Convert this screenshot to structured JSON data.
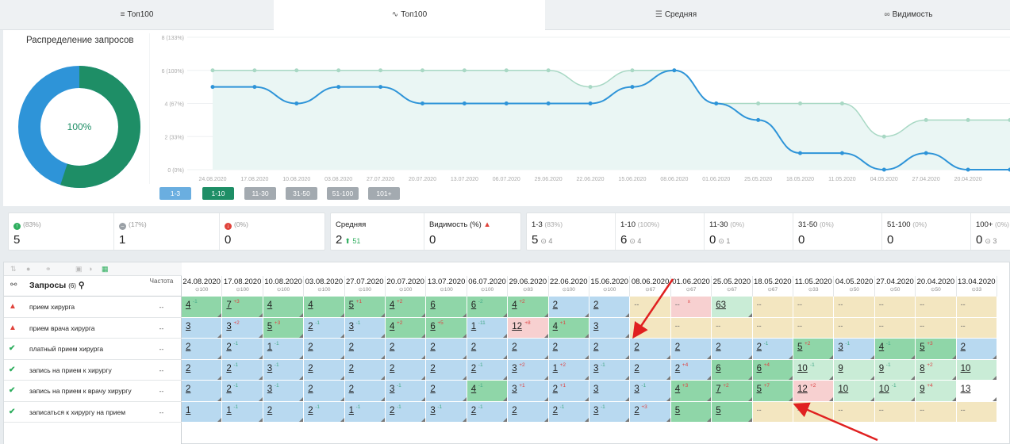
{
  "tabs": [
    {
      "label": "Топ100",
      "icon": "layers-icon"
    },
    {
      "label": "Топ100",
      "icon": "trend-icon"
    },
    {
      "label": "Средняя",
      "icon": "list-icon"
    },
    {
      "label": "Видимость",
      "icon": "glasses-icon"
    }
  ],
  "distribution": {
    "title": "Распределение запросов",
    "center": "100%",
    "segments": [
      {
        "color": "#2e94d8",
        "share": 0.45
      },
      {
        "color": "#1e8e66",
        "share": 0.55
      }
    ]
  },
  "chart_data": {
    "type": "line",
    "y_ticks": [
      "0 (0%)",
      "2 (33%)",
      "4 (67%)",
      "6 (100%)",
      "8 (133%)"
    ],
    "ylim": [
      0,
      8
    ],
    "x": [
      "24.08.2020",
      "17.08.2020",
      "10.08.2020",
      "03.08.2020",
      "27.07.2020",
      "20.07.2020",
      "13.07.2020",
      "06.07.2020",
      "29.06.2020",
      "22.06.2020",
      "15.06.2020",
      "08.06.2020",
      "01.06.2020",
      "25.05.2020",
      "18.05.2020",
      "11.05.2020",
      "04.05.2020",
      "27.04.2020",
      "20.04.2020"
    ],
    "series": [
      {
        "values": [
          6,
          6,
          6,
          6,
          6,
          6,
          6,
          6,
          6,
          5,
          6,
          6,
          4,
          4,
          4,
          4,
          2,
          3,
          3,
          3
        ],
        "color": "#a8d8c4"
      },
      {
        "values": [
          5,
          5,
          4,
          5,
          5,
          4,
          4,
          4,
          4,
          4,
          5,
          6,
          4,
          3,
          1,
          1,
          0,
          1,
          0,
          0
        ],
        "color": "#2e94d8"
      }
    ],
    "ranges": [
      {
        "label": "1-3",
        "color": "#6aaee0"
      },
      {
        "label": "1-10",
        "color": "#1e8e66"
      },
      {
        "label": "11-30",
        "color": "#a3aab0"
      },
      {
        "label": "31-50",
        "color": "#a3aab0"
      },
      {
        "label": "51-100",
        "color": "#a3aab0"
      },
      {
        "label": "101+",
        "color": "#a3aab0"
      }
    ]
  },
  "stats": {
    "movement": [
      {
        "pct": "(83%)",
        "value": "5",
        "color": "#2eae5e",
        "icon": "arrow-up-icon"
      },
      {
        "pct": "(17%)",
        "value": "1",
        "color": "#9aa0a6",
        "icon": "minus-icon"
      },
      {
        "pct": "(0%)",
        "value": "0",
        "color": "#e0433b",
        "icon": "arrow-down-icon"
      }
    ],
    "avg": {
      "label": "Средняя",
      "value": "2",
      "delta": "51"
    },
    "visibility": {
      "label": "Видимость (%)",
      "value": "0"
    },
    "ranges": [
      {
        "label": "1-3",
        "pct": "(83%)",
        "value": "5",
        "delta": "4"
      },
      {
        "label": "1-10",
        "pct": "(100%)",
        "value": "6",
        "delta": "4"
      },
      {
        "label": "11-30",
        "pct": "(0%)",
        "value": "0",
        "delta": "1"
      },
      {
        "label": "31-50",
        "pct": "(0%)",
        "value": "0",
        "delta": ""
      },
      {
        "label": "51-100",
        "pct": "(0%)",
        "value": "0",
        "delta": ""
      },
      {
        "label": "100+",
        "pct": "(0%)",
        "value": "0",
        "delta": "3"
      }
    ]
  },
  "table": {
    "header": {
      "queries": "Запросы",
      "count": "(6)",
      "freq": "Частота"
    },
    "dates": [
      {
        "d": "24.08.2020",
        "s": "100"
      },
      {
        "d": "17.08.2020",
        "s": "100"
      },
      {
        "d": "10.08.2020",
        "s": "100"
      },
      {
        "d": "03.08.2020",
        "s": "100"
      },
      {
        "d": "27.07.2020",
        "s": "100"
      },
      {
        "d": "20.07.2020",
        "s": "100"
      },
      {
        "d": "13.07.2020",
        "s": "100"
      },
      {
        "d": "06.07.2020",
        "s": "100"
      },
      {
        "d": "29.06.2020",
        "s": "83"
      },
      {
        "d": "22.06.2020",
        "s": "100"
      },
      {
        "d": "15.06.2020",
        "s": "100"
      },
      {
        "d": "08.06.2020",
        "s": "67"
      },
      {
        "d": "01.06.2020",
        "s": "67"
      },
      {
        "d": "25.05.2020",
        "s": "67"
      },
      {
        "d": "18.05.2020",
        "s": "67"
      },
      {
        "d": "11.05.2020",
        "s": "33"
      },
      {
        "d": "04.05.2020",
        "s": "50"
      },
      {
        "d": "27.04.2020",
        "s": "50"
      },
      {
        "d": "20.04.2020",
        "s": "50"
      },
      {
        "d": "13.04.2020",
        "s": "33"
      }
    ],
    "rows": [
      {
        "kw": "прием хирурга",
        "status": "warn",
        "freq": "--",
        "cells": [
          [
            "4",
            "-1",
            "g"
          ],
          [
            "7",
            "+3",
            "g"
          ],
          [
            "4",
            "",
            "g"
          ],
          [
            "4",
            "",
            "g"
          ],
          [
            "5",
            "+1",
            "g"
          ],
          [
            "4",
            "+2",
            "g"
          ],
          [
            "6",
            "",
            "g"
          ],
          [
            "6",
            "-2",
            "g"
          ],
          [
            "4",
            "+2",
            "g"
          ],
          [
            "2",
            "",
            "b"
          ],
          [
            "2",
            "",
            "b"
          ],
          [
            "--",
            "",
            "y"
          ],
          [
            "--",
            "x",
            "r"
          ],
          [
            "63",
            "",
            "l"
          ],
          [
            "--",
            "",
            "y"
          ],
          [
            "--",
            "",
            "y"
          ],
          [
            "--",
            "",
            "y"
          ],
          [
            "--",
            "",
            "y"
          ],
          [
            "--",
            "",
            "y"
          ],
          [
            "--",
            "",
            "y"
          ]
        ]
      },
      {
        "kw": "прием врача хирурга",
        "status": "warn",
        "freq": "--",
        "cells": [
          [
            "3",
            "",
            "b"
          ],
          [
            "3",
            "+2",
            "b"
          ],
          [
            "5",
            "+3",
            "g"
          ],
          [
            "2",
            "-1",
            "b"
          ],
          [
            "3",
            "-1",
            "b"
          ],
          [
            "4",
            "+2",
            "g"
          ],
          [
            "6",
            "+5",
            "g"
          ],
          [
            "1",
            "-11",
            "b"
          ],
          [
            "12",
            "+8",
            "r"
          ],
          [
            "4",
            "+1",
            "g"
          ],
          [
            "3",
            "",
            "b"
          ],
          [
            "--",
            "",
            "y"
          ],
          [
            "--",
            "",
            "y"
          ],
          [
            "--",
            "",
            "y"
          ],
          [
            "--",
            "",
            "y"
          ],
          [
            "--",
            "",
            "y"
          ],
          [
            "--",
            "",
            "y"
          ],
          [
            "--",
            "",
            "y"
          ],
          [
            "--",
            "",
            "y"
          ],
          [
            "--",
            "",
            "y"
          ]
        ]
      },
      {
        "kw": "платный прием хирурга",
        "status": "ok",
        "freq": "--",
        "cells": [
          [
            "2",
            "",
            "b"
          ],
          [
            "2",
            "-1",
            "b"
          ],
          [
            "1",
            "-1",
            "b"
          ],
          [
            "2",
            "",
            "b"
          ],
          [
            "2",
            "",
            "b"
          ],
          [
            "2",
            "",
            "b"
          ],
          [
            "2",
            "",
            "b"
          ],
          [
            "2",
            "",
            "b"
          ],
          [
            "2",
            "",
            "b"
          ],
          [
            "2",
            "",
            "b"
          ],
          [
            "2",
            "",
            "b"
          ],
          [
            "2",
            "",
            "b"
          ],
          [
            "2",
            "",
            "b"
          ],
          [
            "2",
            "",
            "b"
          ],
          [
            "2",
            "-1",
            "b"
          ],
          [
            "5",
            "+2",
            "g"
          ],
          [
            "3",
            "-1",
            "b"
          ],
          [
            "4",
            "-1",
            "g"
          ],
          [
            "5",
            "+3",
            "g"
          ],
          [
            "2",
            "",
            "b"
          ]
        ]
      },
      {
        "kw": "запись на прием к хирургу",
        "status": "ok",
        "freq": "--",
        "cells": [
          [
            "2",
            "",
            "b"
          ],
          [
            "2",
            "-1",
            "b"
          ],
          [
            "3",
            "-1",
            "b"
          ],
          [
            "2",
            "",
            "b"
          ],
          [
            "2",
            "",
            "b"
          ],
          [
            "2",
            "",
            "b"
          ],
          [
            "2",
            "",
            "b"
          ],
          [
            "2",
            "-1",
            "b"
          ],
          [
            "3",
            "+2",
            "b"
          ],
          [
            "1",
            "+2",
            "b"
          ],
          [
            "3",
            "-1",
            "b"
          ],
          [
            "2",
            "",
            "b"
          ],
          [
            "2",
            "+4",
            "b"
          ],
          [
            "6",
            "",
            "g"
          ],
          [
            "6",
            "+4",
            "g"
          ],
          [
            "10",
            "-1",
            "l"
          ],
          [
            "9",
            "",
            "l"
          ],
          [
            "9",
            "-1",
            "l"
          ],
          [
            "8",
            "+2",
            "l"
          ],
          [
            "10",
            "",
            "l"
          ]
        ]
      },
      {
        "kw": "запись на прием к врачу хирургу",
        "status": "ok",
        "freq": "--",
        "cells": [
          [
            "2",
            "",
            "b"
          ],
          [
            "2",
            "-1",
            "b"
          ],
          [
            "3",
            "-1",
            "b"
          ],
          [
            "2",
            "",
            "b"
          ],
          [
            "2",
            "",
            "b"
          ],
          [
            "3",
            "-1",
            "b"
          ],
          [
            "2",
            "",
            "b"
          ],
          [
            "4",
            "-1",
            "g"
          ],
          [
            "3",
            "+1",
            "b"
          ],
          [
            "2",
            "+1",
            "b"
          ],
          [
            "3",
            "",
            "b"
          ],
          [
            "3",
            "-1",
            "b"
          ],
          [
            "4",
            "+3",
            "g"
          ],
          [
            "7",
            "+2",
            "g"
          ],
          [
            "5",
            "+7",
            "g"
          ],
          [
            "12",
            "+2",
            "r"
          ],
          [
            "10",
            "",
            "l"
          ],
          [
            "10",
            "-1",
            "l"
          ],
          [
            "9",
            "+4",
            "l"
          ],
          [
            "13",
            "",
            "w"
          ]
        ]
      },
      {
        "kw": "записаться к хирургу на прием",
        "status": "ok",
        "freq": "--",
        "cells": [
          [
            "1",
            "",
            "b"
          ],
          [
            "1",
            "-1",
            "b"
          ],
          [
            "2",
            "",
            "b"
          ],
          [
            "2",
            "-1",
            "b"
          ],
          [
            "1",
            "-1",
            "b"
          ],
          [
            "2",
            "-1",
            "b"
          ],
          [
            "3",
            "-1",
            "b"
          ],
          [
            "2",
            "-1",
            "b"
          ],
          [
            "2",
            "",
            "b"
          ],
          [
            "2",
            "-1",
            "b"
          ],
          [
            "3",
            "-1",
            "b"
          ],
          [
            "2",
            "+3",
            "b"
          ],
          [
            "5",
            "",
            "g"
          ],
          [
            "5",
            "",
            "g"
          ],
          [
            "--",
            "",
            "y"
          ],
          [
            "--",
            "",
            "y"
          ],
          [
            "--",
            "",
            "y"
          ],
          [
            "--",
            "",
            "y"
          ],
          [
            "--",
            "",
            "y"
          ],
          [
            "--",
            "",
            "y"
          ]
        ]
      }
    ]
  },
  "colors": {
    "b": "#b8d9f0",
    "g": "#8fd6a8",
    "y": "#f3e6c0",
    "r": "#f7d0d0",
    "l": "#c9ecd6",
    "w": "#ffffff",
    "arrow": "#e02020"
  }
}
